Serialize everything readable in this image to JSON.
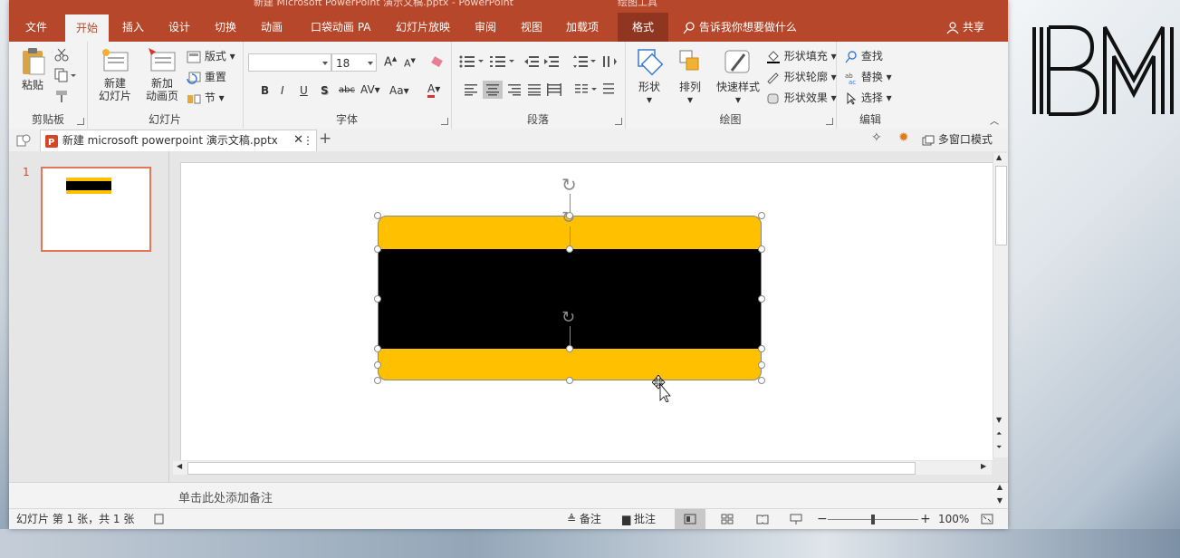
{
  "window": {
    "title": "新建 Microsoft PowerPoint 演示文稿.pptx - PowerPoint",
    "context_label": "绘图工具"
  },
  "tabs": [
    {
      "label": "文件"
    },
    {
      "label": "开始",
      "active": true
    },
    {
      "label": "插入"
    },
    {
      "label": "设计"
    },
    {
      "label": "切换"
    },
    {
      "label": "动画"
    },
    {
      "label": "口袋动画 PA"
    },
    {
      "label": "幻灯片放映"
    },
    {
      "label": "审阅"
    },
    {
      "label": "视图"
    },
    {
      "label": "加载项"
    },
    {
      "label": "格式",
      "contextual": true
    }
  ],
  "tell_me": "告诉我你想要做什么",
  "share": "共享",
  "ribbon": {
    "clipboard": {
      "label": "剪贴板",
      "paste": "粘贴"
    },
    "slides": {
      "label": "幻灯片",
      "new_slide": [
        "新建",
        "幻灯片"
      ],
      "new_anim_page": [
        "新加",
        "动画页"
      ],
      "layout": "版式",
      "reset": "重置",
      "section": "节"
    },
    "font": {
      "label": "字体",
      "font_name": "",
      "font_size": "18",
      "bold": "B",
      "italic": "I",
      "underline": "U",
      "shadow": "S",
      "strike": "abc",
      "spacing": "AV",
      "case": "Aa",
      "color": "A"
    },
    "paragraph": {
      "label": "段落"
    },
    "drawing": {
      "label": "绘图",
      "shapes": "形状",
      "arrange": "排列",
      "quick_styles": "快速样式",
      "fill": "形状填充",
      "outline": "形状轮廓",
      "effects": "形状效果"
    },
    "editing": {
      "label": "编辑",
      "find": "查找",
      "replace": "替换",
      "select": "选择"
    }
  },
  "doc_tab": {
    "name": "新建 microsoft powerpoint 演示文稿.pptx",
    "multi_window": "多窗口模式"
  },
  "slide_panel": {
    "slide_number": "1"
  },
  "notes_placeholder": "单击此处添加备注",
  "status": {
    "slide_info": "幻灯片 第 1 张，共 1 张",
    "notes": "备注",
    "comments": "批注",
    "zoom": "100%"
  },
  "colors": {
    "accent": "#B7472A",
    "gold": "#FFC000",
    "black": "#000000",
    "thumb_border": "#E07757"
  },
  "brand_mark": "BM"
}
